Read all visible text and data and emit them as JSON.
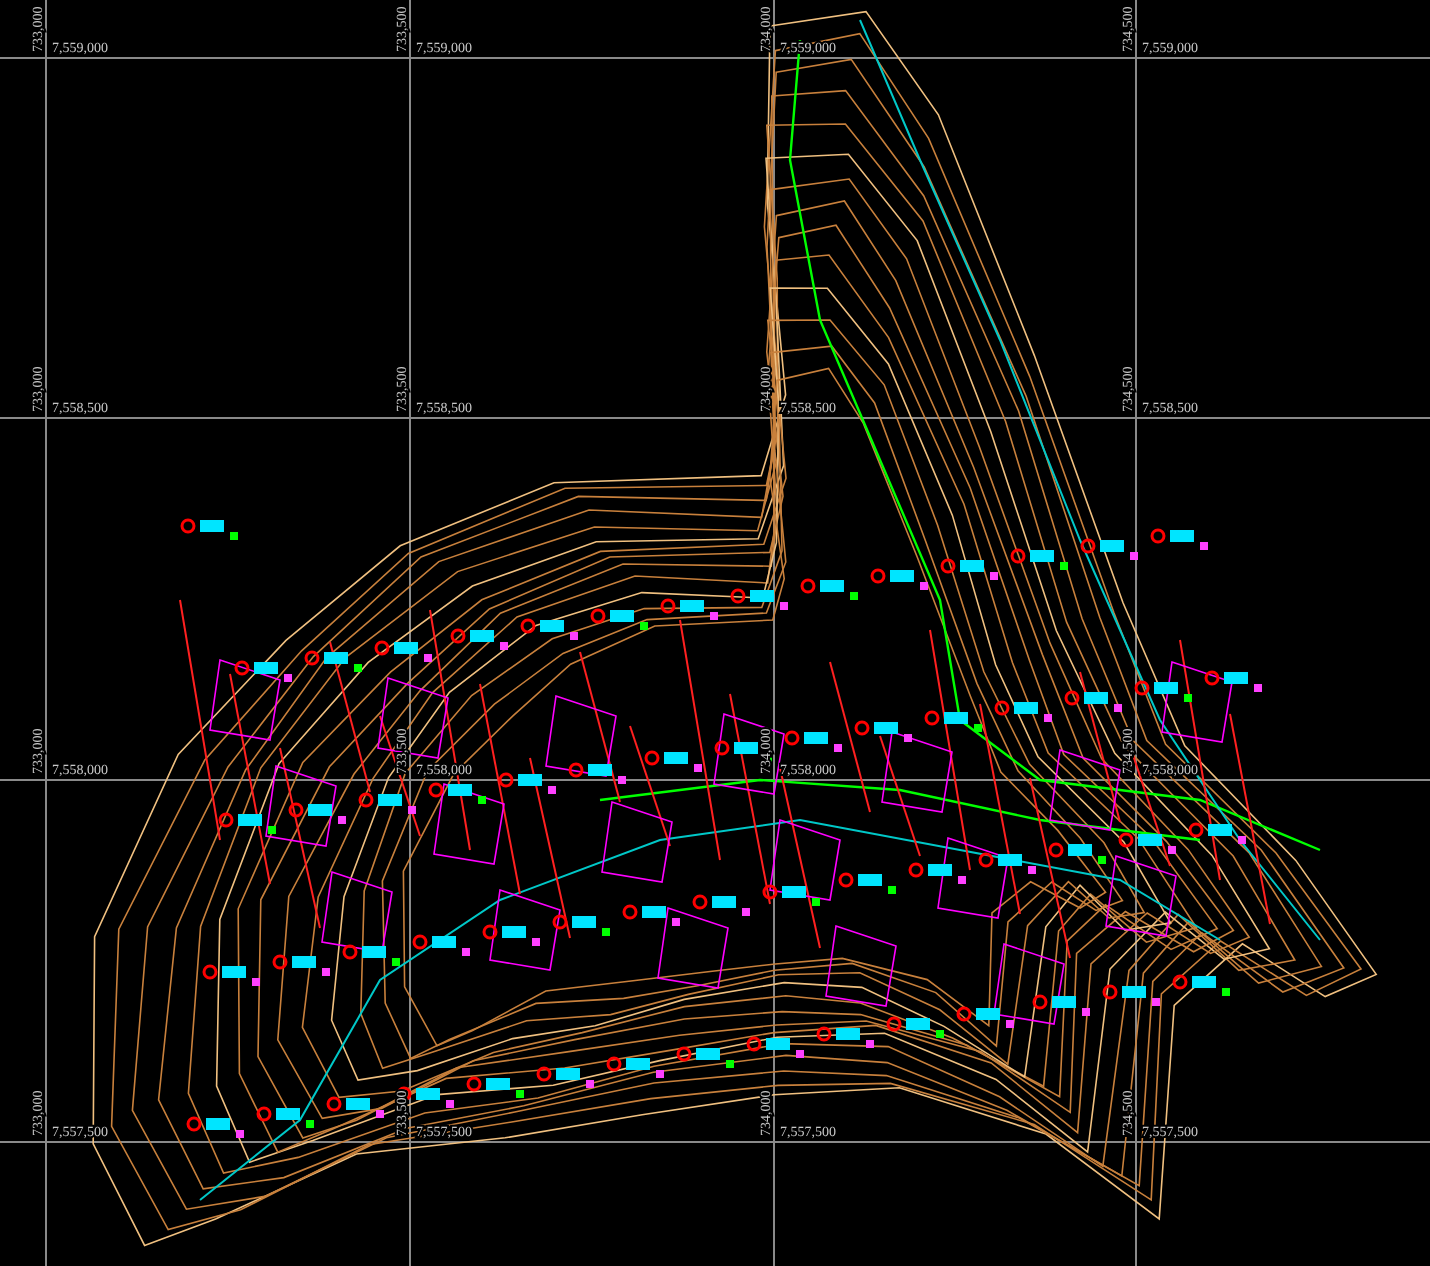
{
  "grid_labels": [
    {
      "easting": "733,000",
      "northing": "7,559,000"
    },
    {
      "easting": "733,500",
      "northing": "7,559,000"
    },
    {
      "easting": "734,000",
      "northing": "7,559,000"
    },
    {
      "easting": "734,500",
      "northing": "7,559,000"
    },
    {
      "easting": "733,000",
      "northing": "7,558,500"
    },
    {
      "easting": "733,500",
      "northing": "7,558,500"
    },
    {
      "easting": "734,000",
      "northing": "7,558,500"
    },
    {
      "easting": "734,500",
      "northing": "7,558,500"
    },
    {
      "easting": "733,000",
      "northing": "7,558,000"
    },
    {
      "easting": "733,500",
      "northing": "7,558,000"
    },
    {
      "easting": "734,000",
      "northing": "7,558,000"
    },
    {
      "easting": "734,500",
      "northing": "7,558,000"
    },
    {
      "easting": "733,000",
      "northing": "7,557,500"
    },
    {
      "easting": "733,500",
      "northing": "7,557,500"
    },
    {
      "easting": "734,000",
      "northing": "7,557,500"
    },
    {
      "easting": "734,500",
      "northing": "7,557,500"
    }
  ]
}
